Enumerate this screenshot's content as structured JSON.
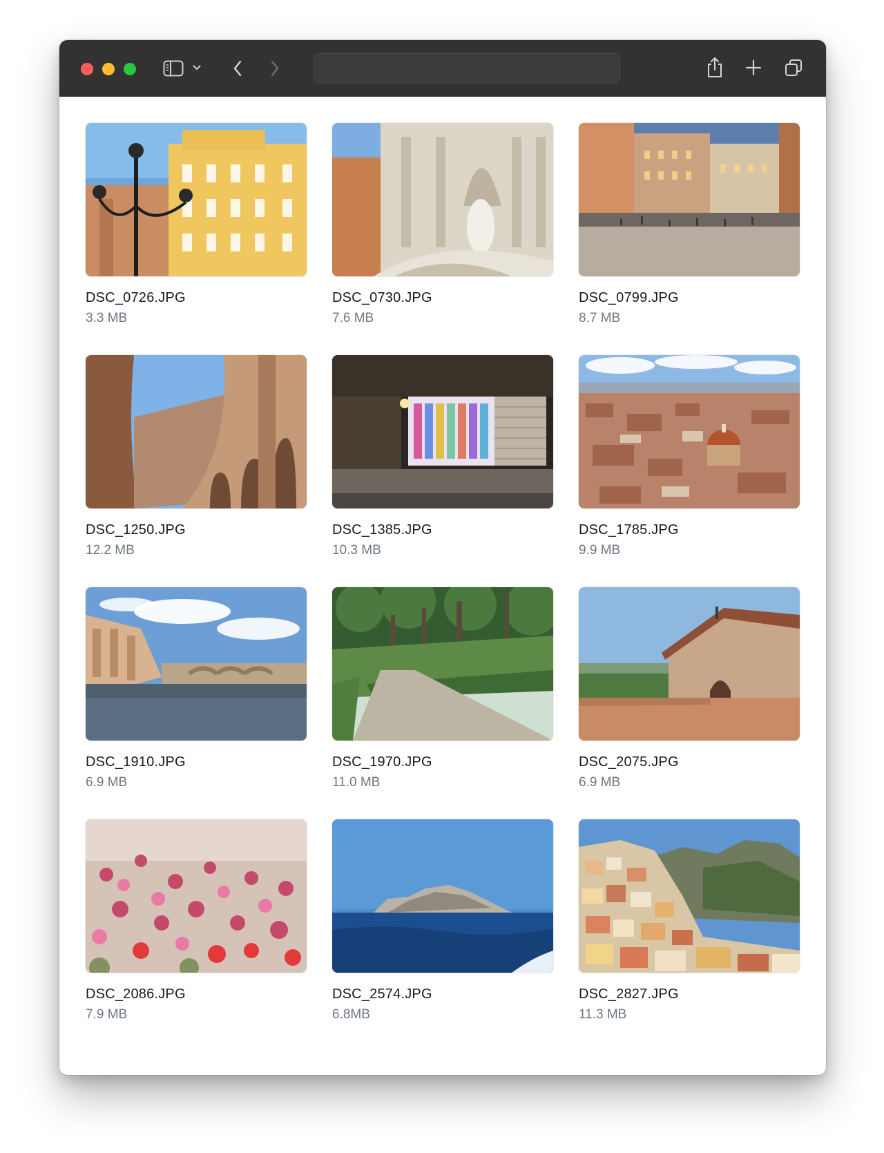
{
  "window": {
    "address_text": "",
    "toolbar_icons": [
      "sidebar-toggle-icon",
      "chevron-down-icon",
      "back-arrow-icon",
      "forward-arrow-icon",
      "share-icon",
      "new-tab-icon",
      "tab-overview-icon"
    ],
    "accent_colors": {
      "close": "#ff5f57",
      "minimize": "#febc2e",
      "zoom": "#28c840",
      "titlebar": "#323232"
    }
  },
  "files": [
    {
      "name": "DSC_0726.JPG",
      "size": "3.3 MB",
      "subject": "yellow building with street lamp"
    },
    {
      "name": "DSC_0730.JPG",
      "size": "7.6 MB",
      "subject": "baroque marble fountain"
    },
    {
      "name": "DSC_0799.JPG",
      "size": "8.7 MB",
      "subject": "piazza at dusk with crowds"
    },
    {
      "name": "DSC_1250.JPG",
      "size": "12.2 MB",
      "subject": "colosseum arches"
    },
    {
      "name": "DSC_1385.JPG",
      "size": "10.3 MB",
      "subject": "lit kiosk at night"
    },
    {
      "name": "DSC_1785.JPG",
      "size": "9.9 MB",
      "subject": "city rooftops with dome"
    },
    {
      "name": "DSC_1910.JPG",
      "size": "6.9 MB",
      "subject": "river with bridge"
    },
    {
      "name": "DSC_1970.JPG",
      "size": "11.0 MB",
      "subject": "garden path with hedges"
    },
    {
      "name": "DSC_2075.JPG",
      "size": "6.9 MB",
      "subject": "stone chapel on terrace"
    },
    {
      "name": "DSC_2086.JPG",
      "size": "7.9 MB",
      "subject": "pink and red flowers"
    },
    {
      "name": "DSC_2574.JPG",
      "size": "6.8MB",
      "subject": "island on sea"
    },
    {
      "name": "DSC_2827.JPG",
      "size": "11.3 MB",
      "subject": "colorful hillside town"
    }
  ]
}
